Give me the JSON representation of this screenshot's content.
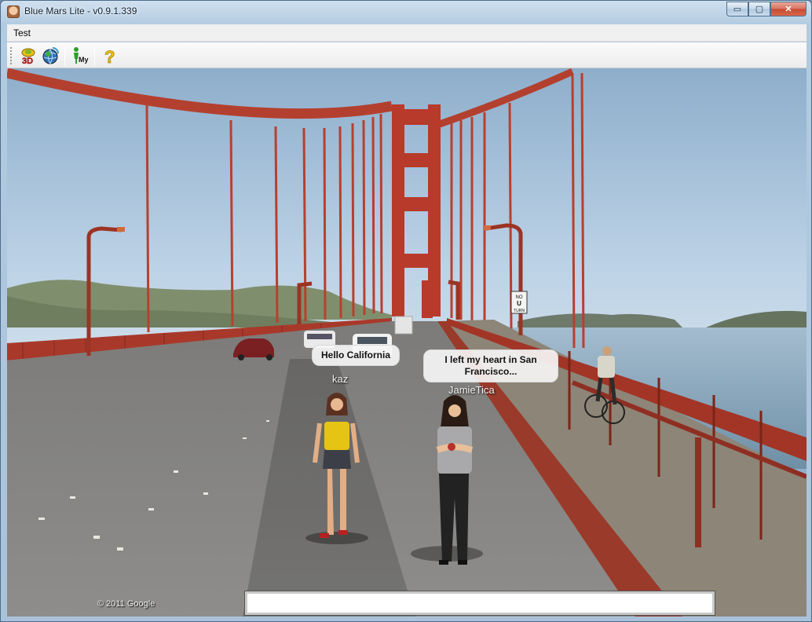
{
  "window": {
    "title": "Blue Mars Lite - v0.9.1.339"
  },
  "caption_buttons": {
    "minimize": "▭",
    "maximize": "▢",
    "close": "✕"
  },
  "menu": {
    "items": [
      "Test"
    ]
  },
  "toolbar": {
    "buttons": [
      {
        "icon": "3d-view-icon",
        "text": "3D"
      },
      {
        "icon": "globe-icon"
      },
      {
        "icon": "my-avatar-icon",
        "text": "My"
      },
      {
        "icon": "help-icon",
        "text": "?"
      }
    ]
  },
  "scene": {
    "avatars": [
      {
        "name": "kaz",
        "chat": "Hello California"
      },
      {
        "name": "JamieTica",
        "chat": "I left my heart in San Francisco..."
      }
    ],
    "copyright": "© 2011 Google",
    "road_sign": {
      "line1": "NO",
      "line2": "U",
      "line3": "TURN"
    }
  },
  "chat_input": {
    "value": ""
  },
  "colors": {
    "bridge": "#b83a2a",
    "sky": "#a9c6e2",
    "road": "#8b8a88"
  }
}
